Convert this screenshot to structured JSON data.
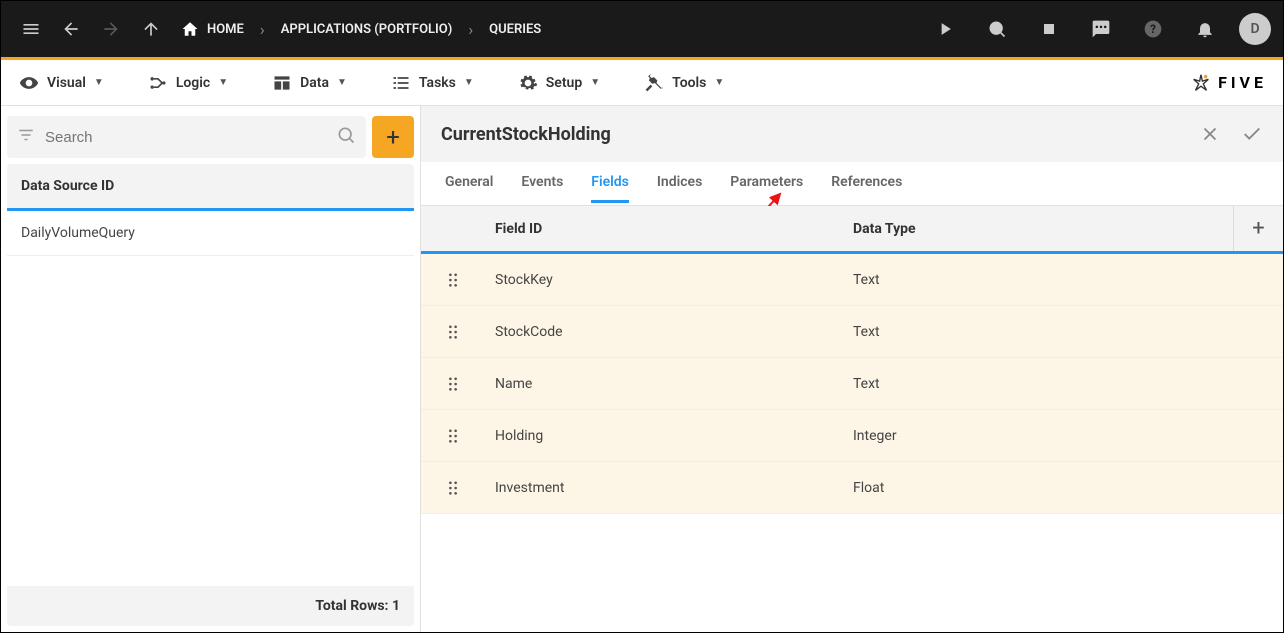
{
  "topbar": {
    "breadcrumbs": [
      {
        "label": "HOME",
        "icon": "home"
      },
      {
        "label": "APPLICATIONS (PORTFOLIO)"
      },
      {
        "label": "QUERIES"
      }
    ],
    "avatar_initial": "D"
  },
  "menubar": {
    "items": [
      {
        "label": "Visual",
        "icon": "visual"
      },
      {
        "label": "Logic",
        "icon": "logic"
      },
      {
        "label": "Data",
        "icon": "data"
      },
      {
        "label": "Tasks",
        "icon": "tasks"
      },
      {
        "label": "Setup",
        "icon": "setup"
      },
      {
        "label": "Tools",
        "icon": "tools"
      }
    ],
    "brand": "FIVE"
  },
  "sidebar": {
    "search_placeholder": "Search",
    "header": "Data Source ID",
    "rows": [
      {
        "label": "DailyVolumeQuery"
      }
    ],
    "footer_label": "Total Rows: 1"
  },
  "content": {
    "title": "CurrentStockHolding",
    "tabs": [
      {
        "label": "General",
        "active": false
      },
      {
        "label": "Events",
        "active": false
      },
      {
        "label": "Fields",
        "active": true
      },
      {
        "label": "Indices",
        "active": false
      },
      {
        "label": "Parameters",
        "active": false
      },
      {
        "label": "References",
        "active": false
      }
    ],
    "columns": {
      "field_id": "Field ID",
      "data_type": "Data Type"
    },
    "rows": [
      {
        "field_id": "StockKey",
        "data_type": "Text"
      },
      {
        "field_id": "StockCode",
        "data_type": "Text"
      },
      {
        "field_id": "Name",
        "data_type": "Text"
      },
      {
        "field_id": "Holding",
        "data_type": "Integer"
      },
      {
        "field_id": "Investment",
        "data_type": "Float"
      }
    ]
  }
}
